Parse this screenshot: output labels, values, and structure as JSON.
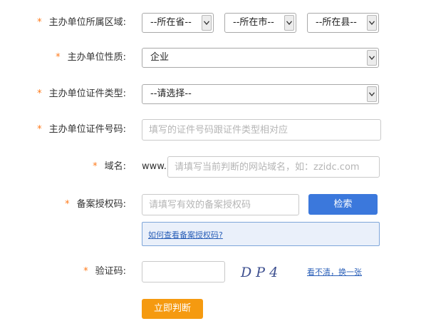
{
  "required_mark": "*",
  "region": {
    "label": "主办单位所属区域:",
    "province": "--所在省--",
    "city": "--所在市--",
    "county": "--所在县--"
  },
  "nature": {
    "label": "主办单位性质:",
    "value": "企业"
  },
  "cert_type": {
    "label": "主办单位证件类型:",
    "value": "--请选择--"
  },
  "cert_number": {
    "label": "主办单位证件号码:",
    "placeholder": "填写的证件号码跟证件类型相对应"
  },
  "domain": {
    "label": "域名:",
    "prefix": "www.",
    "placeholder": "请填写当前判断的网站域名，如：zzidc.com"
  },
  "auth_code": {
    "label": "备案授权码:",
    "placeholder": "请填写有效的备案授权码",
    "search_button": "检索",
    "help_link": "如何查看备案授权码?"
  },
  "captcha": {
    "label": "验证码:",
    "image_text": "D P 4",
    "refresh_link": "看不清，换一张"
  },
  "submit_button": "立即判断",
  "colors": {
    "required_star": "#ff7a1a",
    "search_button": "#3b78dc",
    "submit_button": "#f59a10",
    "link": "#2a5fb8"
  },
  "icons": {
    "select_arrow": "chevron-down-icon"
  }
}
